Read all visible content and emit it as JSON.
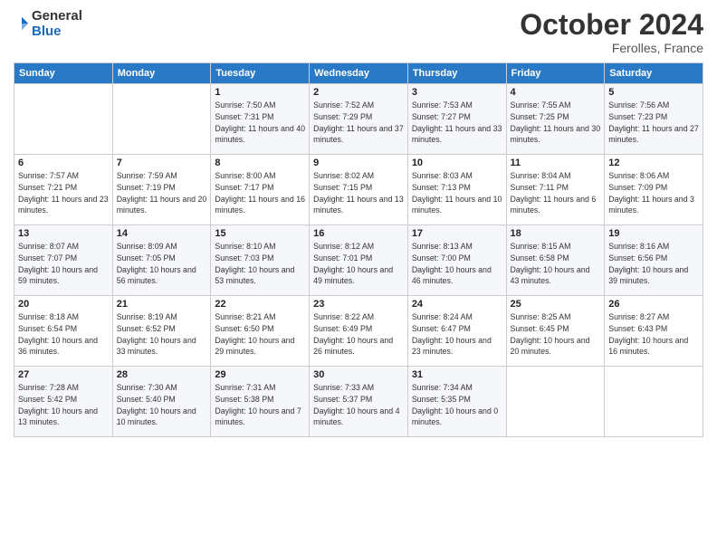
{
  "logo": {
    "general": "General",
    "blue": "Blue"
  },
  "header": {
    "month": "October 2024",
    "location": "Ferolles, France"
  },
  "days_of_week": [
    "Sunday",
    "Monday",
    "Tuesday",
    "Wednesday",
    "Thursday",
    "Friday",
    "Saturday"
  ],
  "weeks": [
    [
      {
        "day": "",
        "info": ""
      },
      {
        "day": "",
        "info": ""
      },
      {
        "day": "1",
        "info": "Sunrise: 7:50 AM\nSunset: 7:31 PM\nDaylight: 11 hours and 40 minutes."
      },
      {
        "day": "2",
        "info": "Sunrise: 7:52 AM\nSunset: 7:29 PM\nDaylight: 11 hours and 37 minutes."
      },
      {
        "day": "3",
        "info": "Sunrise: 7:53 AM\nSunset: 7:27 PM\nDaylight: 11 hours and 33 minutes."
      },
      {
        "day": "4",
        "info": "Sunrise: 7:55 AM\nSunset: 7:25 PM\nDaylight: 11 hours and 30 minutes."
      },
      {
        "day": "5",
        "info": "Sunrise: 7:56 AM\nSunset: 7:23 PM\nDaylight: 11 hours and 27 minutes."
      }
    ],
    [
      {
        "day": "6",
        "info": "Sunrise: 7:57 AM\nSunset: 7:21 PM\nDaylight: 11 hours and 23 minutes."
      },
      {
        "day": "7",
        "info": "Sunrise: 7:59 AM\nSunset: 7:19 PM\nDaylight: 11 hours and 20 minutes."
      },
      {
        "day": "8",
        "info": "Sunrise: 8:00 AM\nSunset: 7:17 PM\nDaylight: 11 hours and 16 minutes."
      },
      {
        "day": "9",
        "info": "Sunrise: 8:02 AM\nSunset: 7:15 PM\nDaylight: 11 hours and 13 minutes."
      },
      {
        "day": "10",
        "info": "Sunrise: 8:03 AM\nSunset: 7:13 PM\nDaylight: 11 hours and 10 minutes."
      },
      {
        "day": "11",
        "info": "Sunrise: 8:04 AM\nSunset: 7:11 PM\nDaylight: 11 hours and 6 minutes."
      },
      {
        "day": "12",
        "info": "Sunrise: 8:06 AM\nSunset: 7:09 PM\nDaylight: 11 hours and 3 minutes."
      }
    ],
    [
      {
        "day": "13",
        "info": "Sunrise: 8:07 AM\nSunset: 7:07 PM\nDaylight: 10 hours and 59 minutes."
      },
      {
        "day": "14",
        "info": "Sunrise: 8:09 AM\nSunset: 7:05 PM\nDaylight: 10 hours and 56 minutes."
      },
      {
        "day": "15",
        "info": "Sunrise: 8:10 AM\nSunset: 7:03 PM\nDaylight: 10 hours and 53 minutes."
      },
      {
        "day": "16",
        "info": "Sunrise: 8:12 AM\nSunset: 7:01 PM\nDaylight: 10 hours and 49 minutes."
      },
      {
        "day": "17",
        "info": "Sunrise: 8:13 AM\nSunset: 7:00 PM\nDaylight: 10 hours and 46 minutes."
      },
      {
        "day": "18",
        "info": "Sunrise: 8:15 AM\nSunset: 6:58 PM\nDaylight: 10 hours and 43 minutes."
      },
      {
        "day": "19",
        "info": "Sunrise: 8:16 AM\nSunset: 6:56 PM\nDaylight: 10 hours and 39 minutes."
      }
    ],
    [
      {
        "day": "20",
        "info": "Sunrise: 8:18 AM\nSunset: 6:54 PM\nDaylight: 10 hours and 36 minutes."
      },
      {
        "day": "21",
        "info": "Sunrise: 8:19 AM\nSunset: 6:52 PM\nDaylight: 10 hours and 33 minutes."
      },
      {
        "day": "22",
        "info": "Sunrise: 8:21 AM\nSunset: 6:50 PM\nDaylight: 10 hours and 29 minutes."
      },
      {
        "day": "23",
        "info": "Sunrise: 8:22 AM\nSunset: 6:49 PM\nDaylight: 10 hours and 26 minutes."
      },
      {
        "day": "24",
        "info": "Sunrise: 8:24 AM\nSunset: 6:47 PM\nDaylight: 10 hours and 23 minutes."
      },
      {
        "day": "25",
        "info": "Sunrise: 8:25 AM\nSunset: 6:45 PM\nDaylight: 10 hours and 20 minutes."
      },
      {
        "day": "26",
        "info": "Sunrise: 8:27 AM\nSunset: 6:43 PM\nDaylight: 10 hours and 16 minutes."
      }
    ],
    [
      {
        "day": "27",
        "info": "Sunrise: 7:28 AM\nSunset: 5:42 PM\nDaylight: 10 hours and 13 minutes."
      },
      {
        "day": "28",
        "info": "Sunrise: 7:30 AM\nSunset: 5:40 PM\nDaylight: 10 hours and 10 minutes."
      },
      {
        "day": "29",
        "info": "Sunrise: 7:31 AM\nSunset: 5:38 PM\nDaylight: 10 hours and 7 minutes."
      },
      {
        "day": "30",
        "info": "Sunrise: 7:33 AM\nSunset: 5:37 PM\nDaylight: 10 hours and 4 minutes."
      },
      {
        "day": "31",
        "info": "Sunrise: 7:34 AM\nSunset: 5:35 PM\nDaylight: 10 hours and 0 minutes."
      },
      {
        "day": "",
        "info": ""
      },
      {
        "day": "",
        "info": ""
      }
    ]
  ]
}
